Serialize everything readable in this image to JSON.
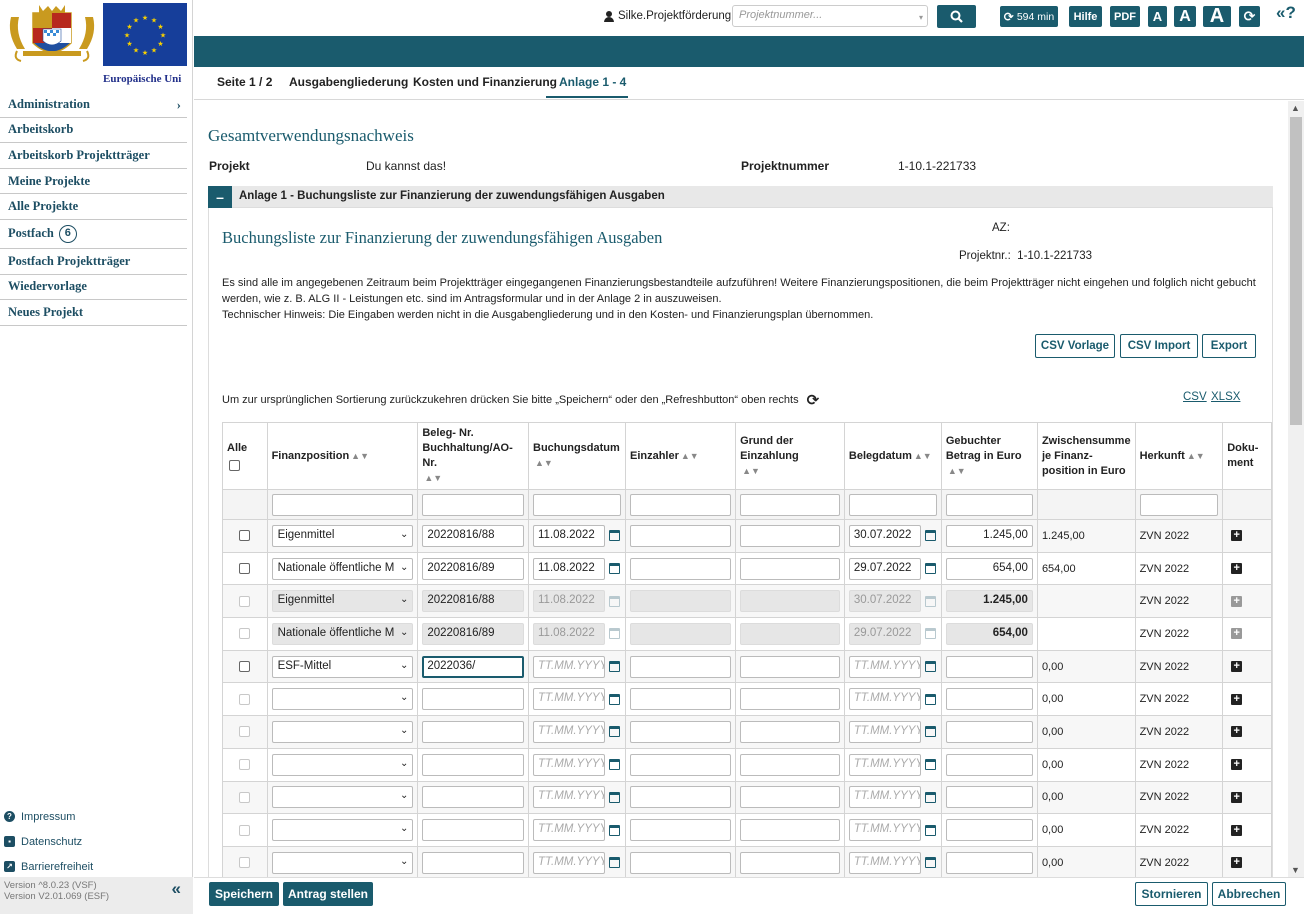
{
  "sidebar": {
    "eu_caption": "Europäische Uni",
    "nav": [
      {
        "label": "Administration"
      },
      {
        "label": "Arbeitskorb"
      },
      {
        "label": "Arbeitskorb Projektträger"
      },
      {
        "label": "Meine Projekte"
      },
      {
        "label": "Alle Projekte"
      },
      {
        "label": "Postfach",
        "badge": "6"
      },
      {
        "label": "Postfach Projektträger"
      },
      {
        "label": "Wiedervorlage"
      },
      {
        "label": "Neues Projekt"
      }
    ],
    "footer": [
      {
        "label": "Impressum",
        "icon": "help-circle-icon"
      },
      {
        "label": "Datenschutz",
        "icon": "id-card-icon"
      },
      {
        "label": "Barrierefreiheit",
        "icon": "external-link-icon"
      }
    ],
    "version_lines": [
      "Version ^8.0.23 (VSF)",
      "Version V2.01.069 (ESF)"
    ]
  },
  "topbar": {
    "user": "Silke.Projektförderung",
    "project_search_placeholder": "Projektnummer...",
    "timer": "594 min",
    "help_label": "Hilfe",
    "pdf_label": "PDF",
    "font_small": "A",
    "font_medium": "A",
    "font_large": "A"
  },
  "tabs": [
    {
      "label": "Seite 1 / 2"
    },
    {
      "label": "Ausgabengliederung"
    },
    {
      "label": "Kosten und Finanzierung"
    },
    {
      "label": "Anlage 1 - 4",
      "active": true
    }
  ],
  "main": {
    "title": "Gesamtverwendungsnachweis",
    "projekt_label": "Projekt",
    "projekt_value": "Du kannst das!",
    "projektnummer_label": "Projektnummer",
    "projektnummer_value": "1-10.1-221733",
    "section_toggle": "–",
    "section_title": "Anlage 1 - Buchungsliste zur Finanzierung der zuwendungsfähigen Ausgaben"
  },
  "panel": {
    "title": "Buchungsliste zur Finanzierung der zuwendungsfähigen Ausgaben",
    "az_label": "AZ:",
    "projektnr_label": "Projektnr.:",
    "projektnr_value": "1-10.1-221733",
    "intro_1": "Es sind alle im angegebenen Zeitraum beim Projektträger eingegangenen Finanzierungsbestandteile aufzuführen! Weitere Finanzierungspositionen, die beim Projektträger nicht eingehen und folglich nicht gebucht werden, wie z. B. ALG II - Leistungen etc. sind im Antragsformular und in der Anlage 2 in auszuweisen.",
    "intro_2": "Technischer Hinweis: Die Eingaben werden nicht in die Ausgabengliederung und in den Kosten- und Finanzierungsplan übernommen.",
    "btn_csv_vorlage": "CSV Vorlage",
    "btn_csv_import": "CSV Import",
    "btn_export": "Export",
    "sort_hint": "Um zur ursprünglichen Sortierung zurückzukehren drücken Sie bitte „Speichern“ oder den „Refreshbutton“ oben rechts",
    "link_csv": "CSV",
    "link_xlsx": "XLSX"
  },
  "table": {
    "headers": {
      "alle": "Alle",
      "finanzposition": "Finanzposition",
      "beleg_nr": "Beleg- Nr. Buchhaltung/AO-Nr.",
      "buchungsdatum": "Buchungsdatum",
      "einzahler": "Einzahler",
      "grund": "Grund der Einzahlung",
      "belegdatum": "Belegdatum",
      "betrag": "Gebuchter Betrag in Euro",
      "zwischensumme": "Zwischensumme je Finanz-position in Euro",
      "herkunft": "Herkunft",
      "dokument": "Doku-ment"
    },
    "date_placeholder": "TT.MM.YYYY",
    "rows": [
      {
        "state": "edit",
        "finanzposition": "Eigenmittel",
        "beleg": "20220816/88",
        "buchungsdatum": "11.08.2022",
        "einzahler": "",
        "grund": "",
        "belegdatum": "30.07.2022",
        "betrag": "1.245,00",
        "zwischensumme": "1.245,00",
        "herkunft": "ZVN 2022"
      },
      {
        "state": "edit",
        "finanzposition": "Nationale öffentliche M",
        "beleg": "20220816/89",
        "buchungsdatum": "11.08.2022",
        "einzahler": "",
        "grund": "",
        "belegdatum": "29.07.2022",
        "betrag": "654,00",
        "zwischensumme": "654,00",
        "herkunft": "ZVN 2022"
      },
      {
        "state": "readonly",
        "finanzposition": "Eigenmittel",
        "beleg": "20220816/88",
        "buchungsdatum": "11.08.2022",
        "einzahler": "",
        "grund": "",
        "belegdatum": "30.07.2022",
        "betrag": "1.245,00",
        "zwischensumme": "",
        "herkunft": "ZVN 2022"
      },
      {
        "state": "readonly",
        "finanzposition": "Nationale öffentliche M",
        "beleg": "20220816/89",
        "buchungsdatum": "11.08.2022",
        "einzahler": "",
        "grund": "",
        "belegdatum": "29.07.2022",
        "betrag": "654,00",
        "zwischensumme": "",
        "herkunft": "ZVN 2022"
      },
      {
        "state": "active",
        "finanzposition": "ESF-Mittel",
        "beleg": "2022036/",
        "buchungsdatum": "",
        "einzahler": "",
        "grund": "",
        "belegdatum": "",
        "betrag": "",
        "zwischensumme": "0,00",
        "herkunft": "ZVN 2022"
      },
      {
        "state": "empty",
        "finanzposition": "",
        "beleg": "",
        "buchungsdatum": "",
        "einzahler": "",
        "grund": "",
        "belegdatum": "",
        "betrag": "",
        "zwischensumme": "0,00",
        "herkunft": "ZVN 2022"
      },
      {
        "state": "empty",
        "finanzposition": "",
        "beleg": "",
        "buchungsdatum": "",
        "einzahler": "",
        "grund": "",
        "belegdatum": "",
        "betrag": "",
        "zwischensumme": "0,00",
        "herkunft": "ZVN 2022"
      },
      {
        "state": "empty",
        "finanzposition": "",
        "beleg": "",
        "buchungsdatum": "",
        "einzahler": "",
        "grund": "",
        "belegdatum": "",
        "betrag": "",
        "zwischensumme": "0,00",
        "herkunft": "ZVN 2022"
      },
      {
        "state": "empty",
        "finanzposition": "",
        "beleg": "",
        "buchungsdatum": "",
        "einzahler": "",
        "grund": "",
        "belegdatum": "",
        "betrag": "",
        "zwischensumme": "0,00",
        "herkunft": "ZVN 2022"
      },
      {
        "state": "empty",
        "finanzposition": "",
        "beleg": "",
        "buchungsdatum": "",
        "einzahler": "",
        "grund": "",
        "belegdatum": "",
        "betrag": "",
        "zwischensumme": "0,00",
        "herkunft": "ZVN 2022"
      },
      {
        "state": "empty",
        "finanzposition": "",
        "beleg": "",
        "buchungsdatum": "",
        "einzahler": "",
        "grund": "",
        "belegdatum": "",
        "betrag": "",
        "zwischensumme": "0,00",
        "herkunft": "ZVN 2022"
      }
    ]
  },
  "actions": {
    "save": "Speichern",
    "submit": "Antrag stellen",
    "cancel_request": "Stornieren",
    "abort": "Abbrechen"
  },
  "colors": {
    "primary": "#1a5b6d",
    "eu_blue": "#163e9a",
    "eu_star": "#f7d000"
  }
}
